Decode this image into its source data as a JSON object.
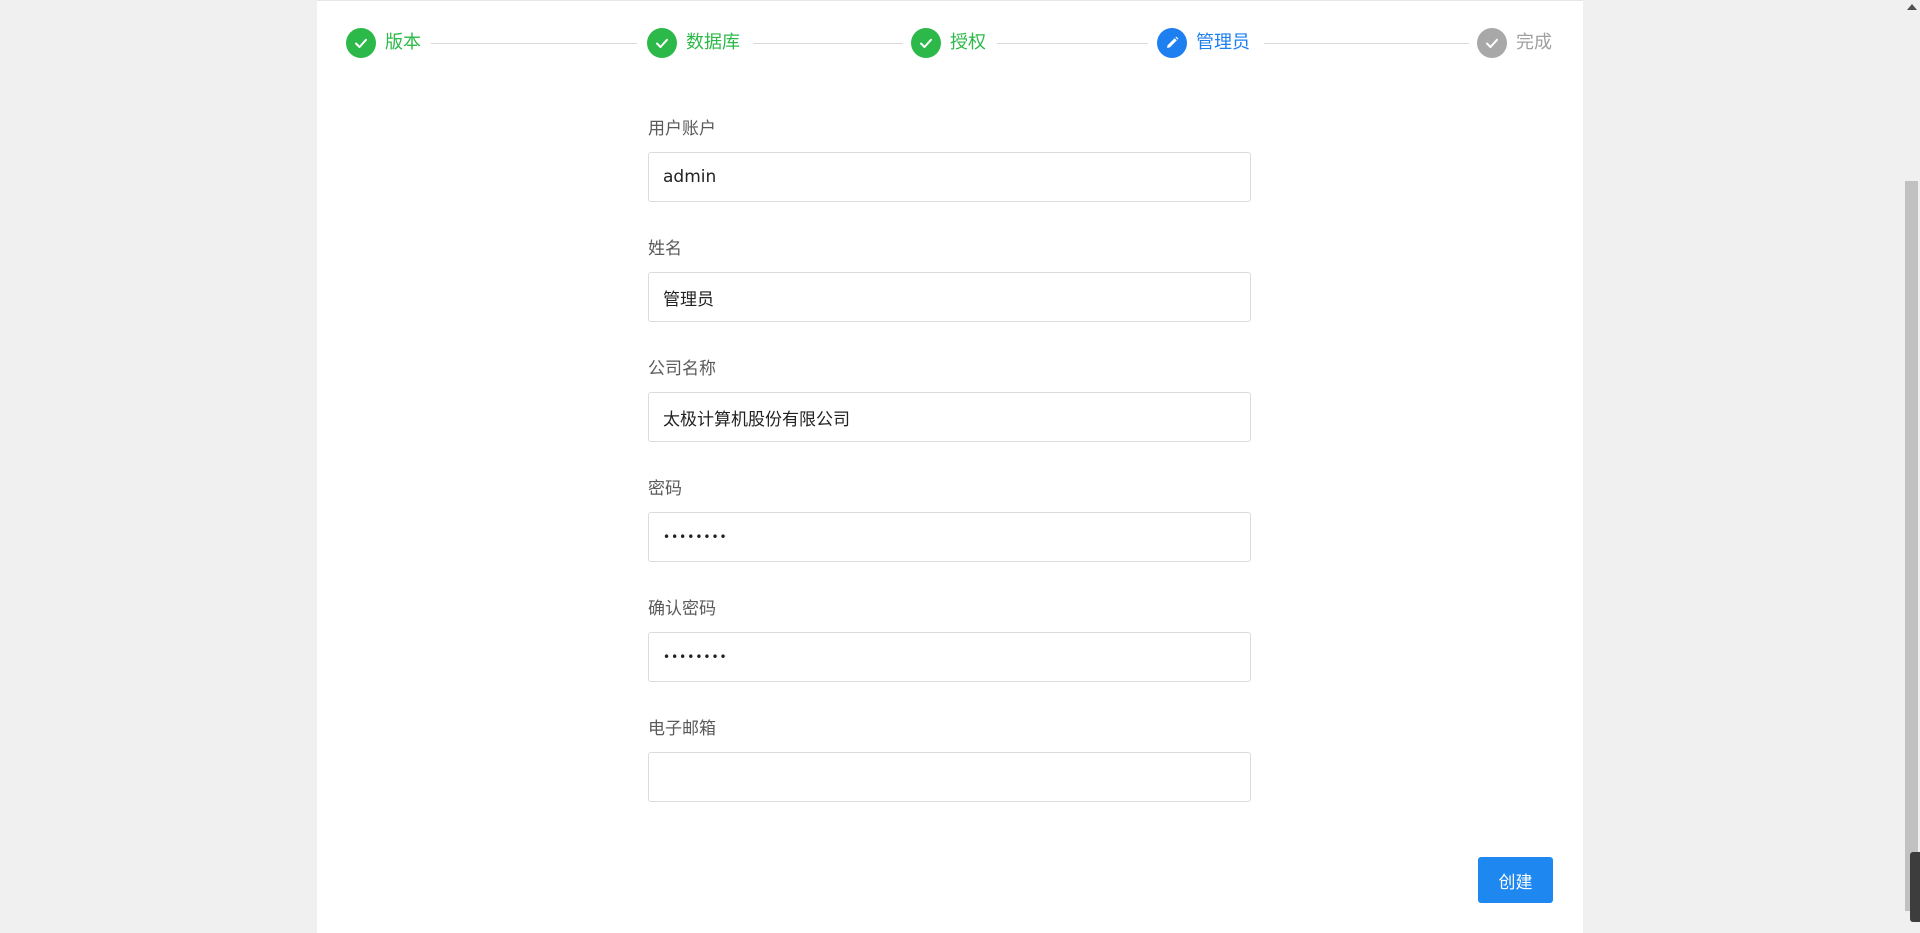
{
  "steps": [
    {
      "label": "版本",
      "status": "done",
      "icon": "check-icon"
    },
    {
      "label": "数据库",
      "status": "done",
      "icon": "check-icon"
    },
    {
      "label": "授权",
      "status": "done",
      "icon": "check-icon"
    },
    {
      "label": "管理员",
      "status": "active",
      "icon": "pencil-icon"
    },
    {
      "label": "完成",
      "status": "wait",
      "icon": "check-icon"
    }
  ],
  "form": {
    "username": {
      "label": "用户账户",
      "value": "admin"
    },
    "name": {
      "label": "姓名",
      "value": "管理员"
    },
    "company": {
      "label": "公司名称",
      "value": "太极计算机股份有限公司"
    },
    "password": {
      "label": "密码",
      "value": "********"
    },
    "confirm_password": {
      "label": "确认密码",
      "value": "********"
    },
    "email": {
      "label": "电子邮箱",
      "value": ""
    }
  },
  "actions": {
    "create_label": "创建"
  },
  "colors": {
    "done": "#2cb949",
    "active": "#1e7ff0",
    "wait": "#a8a8a8",
    "primary_button": "#1e88f0"
  }
}
